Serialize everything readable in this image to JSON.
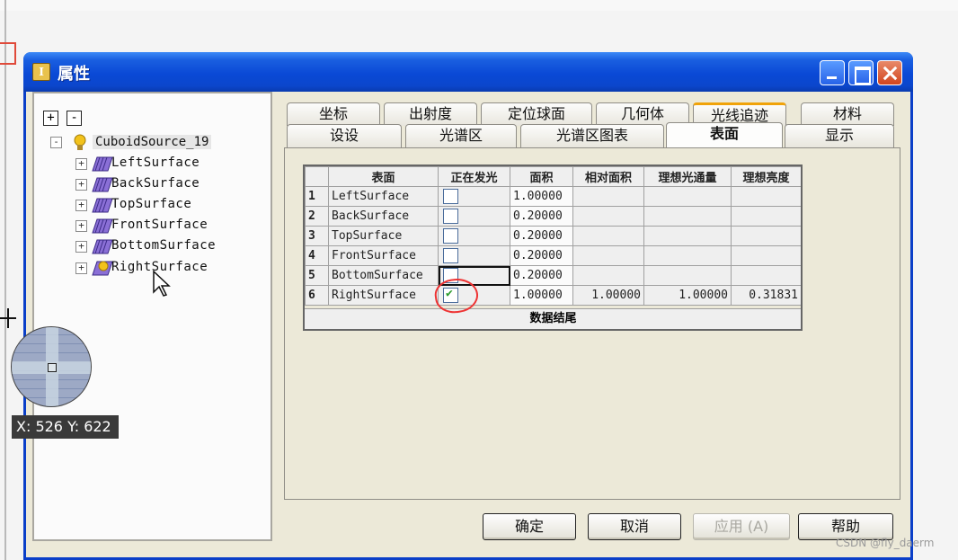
{
  "window": {
    "title": "属性",
    "icon_letter": "I"
  },
  "toolbar": {
    "expand_all": "+",
    "collapse_all": "-"
  },
  "tree": {
    "root": {
      "label": "CuboidSource_19",
      "expander": "-"
    },
    "items": [
      {
        "label": "LeftSurface",
        "expander": "+"
      },
      {
        "label": "BackSurface",
        "expander": "+"
      },
      {
        "label": "TopSurface",
        "expander": "+"
      },
      {
        "label": "FrontSurface",
        "expander": "+"
      },
      {
        "label": "BottomSurface",
        "expander": "+"
      },
      {
        "label": "RightSurface",
        "expander": "+"
      }
    ]
  },
  "tabs": {
    "row1": [
      "坐标",
      "出射度",
      "定位球面",
      "几何体",
      "光线追迹",
      "材料"
    ],
    "row2": [
      "设设",
      "光谱区",
      "光谱区图表",
      "表面",
      "显示"
    ],
    "active": "表面"
  },
  "grid": {
    "headers": [
      "表面",
      "正在发光",
      "面积",
      "相对面积",
      "理想光通量",
      "理想亮度"
    ],
    "rows": [
      {
        "num": "1",
        "name": "LeftSurface",
        "emitting": false,
        "area": "1.00000",
        "rel_area": "",
        "flux": "",
        "lum": ""
      },
      {
        "num": "2",
        "name": "BackSurface",
        "emitting": false,
        "area": "0.20000",
        "rel_area": "",
        "flux": "",
        "lum": ""
      },
      {
        "num": "3",
        "name": "TopSurface",
        "emitting": false,
        "area": "0.20000",
        "rel_area": "",
        "flux": "",
        "lum": ""
      },
      {
        "num": "4",
        "name": "FrontSurface",
        "emitting": false,
        "area": "0.20000",
        "rel_area": "",
        "flux": "",
        "lum": ""
      },
      {
        "num": "5",
        "name": "BottomSurface",
        "emitting": false,
        "area": "0.20000",
        "rel_area": "",
        "flux": "",
        "lum": ""
      },
      {
        "num": "6",
        "name": "RightSurface",
        "emitting": true,
        "area": "1.00000",
        "rel_area": "1.00000",
        "flux": "1.00000",
        "lum": "0.31831"
      }
    ],
    "end_label": "数据结尾"
  },
  "buttons": {
    "ok": "确定",
    "cancel": "取消",
    "apply": "应用 (A)",
    "help": "帮助"
  },
  "overlay": {
    "coord_readout": "X: 526 Y: 622",
    "watermark": "CSDN @fly_daerm"
  },
  "colors": {
    "titlebar": "#0a49d6",
    "accent_underline": "#e53a3a",
    "annotation_circle": "#e33333",
    "check": "#2a9a2a"
  }
}
